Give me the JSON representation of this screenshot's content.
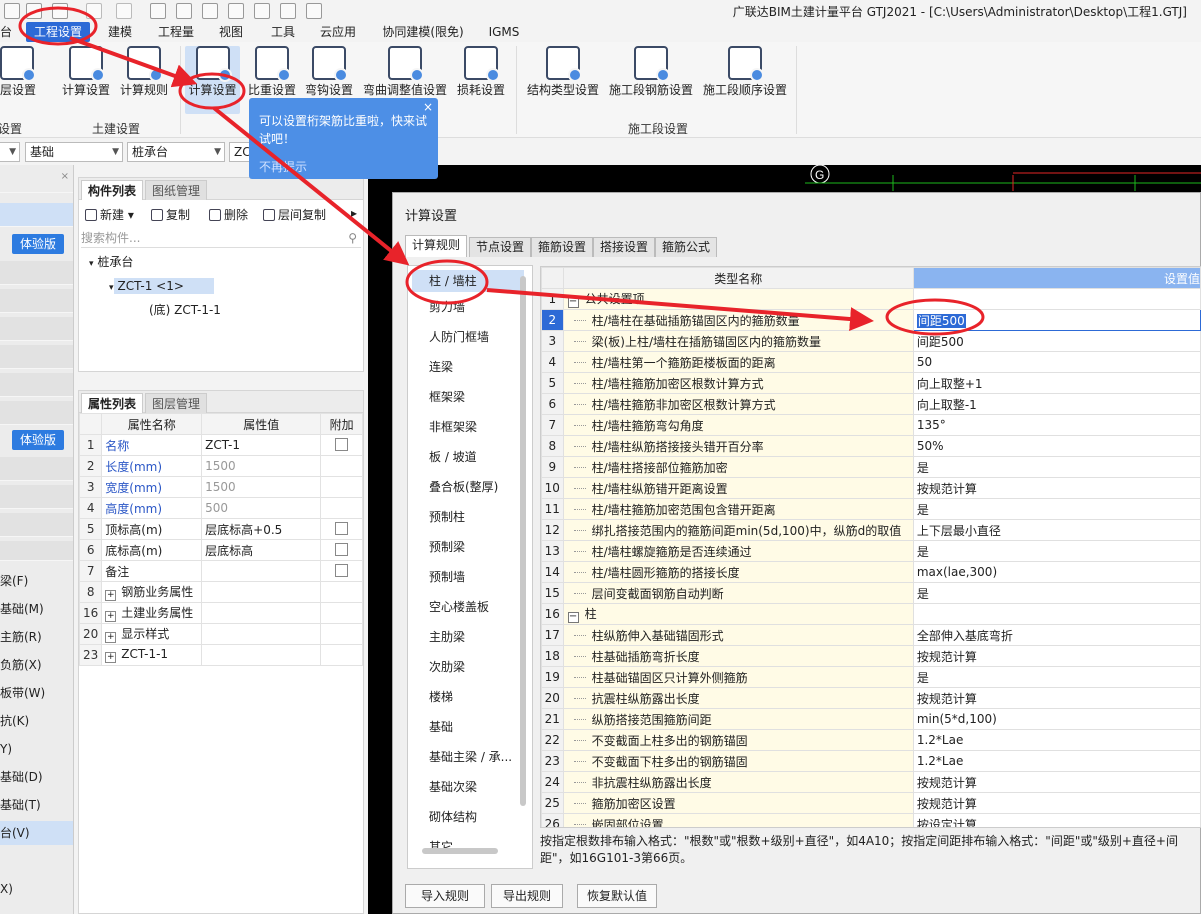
{
  "app": {
    "title": "广联达BIM土建计量平台 GTJ2021 - [C:\\Users\\Administrator\\Desktop\\工程1.GTJ]"
  },
  "menu": {
    "items": [
      "台",
      "工程设置",
      "建模",
      "工程量",
      "视图",
      "工具",
      "云应用",
      "协同建模(限免)",
      "IGMS"
    ],
    "active_index": 1
  },
  "ribbon": {
    "buttons": [
      "楼层设置",
      "计算设置",
      "计算规则",
      "计算设置",
      "比重设置",
      "弯钩设置",
      "弯曲调整值设置",
      "损耗设置",
      "结构类型设置",
      "施工段钢筋设置",
      "施工段顺序设置"
    ],
    "groups": [
      "设置",
      "土建设置",
      "施工段设置"
    ]
  },
  "tooltip": {
    "text": "可以设置桁架筋比重啦，快来试试吧！",
    "dismiss": "不再提示",
    "close": "×"
  },
  "dropdowns": [
    "基础",
    "桩承台",
    "ZC"
  ],
  "leftstrip": {
    "trial_label": "体验版",
    "items": [
      "梁(F)",
      "基础(M)",
      "主筋(R)",
      "负筋(X)",
      "板带(W)",
      "抗(K)",
      "Y)",
      "基础(D)",
      "基础(T)",
      "台(V)",
      "X)"
    ],
    "selected_index": 9
  },
  "component_list": {
    "tabs": [
      "构件列表",
      "图纸管理"
    ],
    "toolbar": [
      "新建",
      "复制",
      "删除",
      "层间复制"
    ],
    "more": "▸",
    "search_placeholder": "搜索构件...",
    "tree": {
      "root": "桩承台",
      "child": "ZCT-1 <1>",
      "leaf": "(底) ZCT-1-1"
    }
  },
  "property_list": {
    "tabs": [
      "属性列表",
      "图层管理"
    ],
    "headers": [
      "属性名称",
      "属性值",
      "附加"
    ],
    "rows": [
      {
        "no": "1",
        "name": "名称",
        "value": "ZCT-1",
        "check": false,
        "blue": true,
        "gray": false,
        "plus": false
      },
      {
        "no": "2",
        "name": "长度(mm)",
        "value": "1500",
        "check": null,
        "blue": true,
        "gray": true,
        "plus": false
      },
      {
        "no": "3",
        "name": "宽度(mm)",
        "value": "1500",
        "check": null,
        "blue": true,
        "gray": true,
        "plus": false
      },
      {
        "no": "4",
        "name": "高度(mm)",
        "value": "500",
        "check": null,
        "blue": true,
        "gray": true,
        "plus": false
      },
      {
        "no": "5",
        "name": "顶标高(m)",
        "value": "层底标高+0.5",
        "check": false,
        "blue": false,
        "gray": false,
        "plus": false
      },
      {
        "no": "6",
        "name": "底标高(m)",
        "value": "层底标高",
        "check": false,
        "blue": false,
        "gray": false,
        "plus": false
      },
      {
        "no": "7",
        "name": "备注",
        "value": "",
        "check": false,
        "blue": false,
        "gray": false,
        "plus": false
      },
      {
        "no": "8",
        "name": "钢筋业务属性",
        "value": "",
        "check": null,
        "blue": false,
        "gray": false,
        "plus": true
      },
      {
        "no": "16",
        "name": "土建业务属性",
        "value": "",
        "check": null,
        "blue": false,
        "gray": false,
        "plus": true
      },
      {
        "no": "20",
        "name": "显示样式",
        "value": "",
        "check": null,
        "blue": false,
        "gray": false,
        "plus": true
      },
      {
        "no": "23",
        "name": "ZCT-1-1",
        "value": "",
        "check": null,
        "blue": false,
        "gray": false,
        "plus": true
      }
    ]
  },
  "canvas": {
    "axis_label": "G"
  },
  "dialog": {
    "title": "计算设置",
    "tabs": [
      "计算规则",
      "节点设置",
      "箍筋设置",
      "搭接设置",
      "箍筋公式"
    ],
    "categories": [
      "柱 / 墙柱",
      "剪力墙",
      "人防门框墙",
      "连梁",
      "框架梁",
      "非框架梁",
      "板 / 坡道",
      "叠合板(整厚)",
      "预制柱",
      "预制梁",
      "预制墙",
      "空心楼盖板",
      "主肋梁",
      "次肋梁",
      "楼梯",
      "基础",
      "基础主梁 / 承...",
      "基础次梁",
      "砌体结构",
      "其它"
    ],
    "selected_category": 0,
    "col_name": "类型名称",
    "col_value": "设置值",
    "rows": [
      {
        "no": "1",
        "name": "公共设置项",
        "value": "",
        "group": true
      },
      {
        "no": "2",
        "name": "柱/墙柱在基础插筋锚固区内的箍筋数量",
        "value": "间距500",
        "group": false,
        "selected": true
      },
      {
        "no": "3",
        "name": "梁(板)上柱/墙柱在插筋锚固区内的箍筋数量",
        "value": "间距500",
        "group": false
      },
      {
        "no": "4",
        "name": "柱/墙柱第一个箍筋距楼板面的距离",
        "value": "50",
        "group": false
      },
      {
        "no": "5",
        "name": "柱/墙柱箍筋加密区根数计算方式",
        "value": "向上取整+1",
        "group": false
      },
      {
        "no": "6",
        "name": "柱/墙柱箍筋非加密区根数计算方式",
        "value": "向上取整-1",
        "group": false
      },
      {
        "no": "7",
        "name": "柱/墙柱箍筋弯勾角度",
        "value": "135°",
        "group": false
      },
      {
        "no": "8",
        "name": "柱/墙柱纵筋搭接接头错开百分率",
        "value": "50%",
        "group": false
      },
      {
        "no": "9",
        "name": "柱/墙柱搭接部位箍筋加密",
        "value": "是",
        "group": false
      },
      {
        "no": "10",
        "name": "柱/墙柱纵筋错开距离设置",
        "value": "按规范计算",
        "group": false
      },
      {
        "no": "11",
        "name": "柱/墙柱箍筋加密范围包含错开距离",
        "value": "是",
        "group": false
      },
      {
        "no": "12",
        "name": "绑扎搭接范围内的箍筋间距min(5d,100)中，纵筋d的取值",
        "value": "上下层最小直径",
        "group": false
      },
      {
        "no": "13",
        "name": "柱/墙柱螺旋箍筋是否连续通过",
        "value": "是",
        "group": false
      },
      {
        "no": "14",
        "name": "柱/墙柱圆形箍筋的搭接长度",
        "value": "max(lae,300)",
        "group": false
      },
      {
        "no": "15",
        "name": "层间变截面钢筋自动判断",
        "value": "是",
        "group": false
      },
      {
        "no": "16",
        "name": "柱",
        "value": "",
        "group": true
      },
      {
        "no": "17",
        "name": "柱纵筋伸入基础锚固形式",
        "value": "全部伸入基底弯折",
        "group": false
      },
      {
        "no": "18",
        "name": "柱基础插筋弯折长度",
        "value": "按规范计算",
        "group": false
      },
      {
        "no": "19",
        "name": "柱基础锚固区只计算外侧箍筋",
        "value": "是",
        "group": false
      },
      {
        "no": "20",
        "name": "抗震柱纵筋露出长度",
        "value": "按规范计算",
        "group": false
      },
      {
        "no": "21",
        "name": "纵筋搭接范围箍筋间距",
        "value": "min(5*d,100)",
        "group": false
      },
      {
        "no": "22",
        "name": "不变截面上柱多出的钢筋锚固",
        "value": "1.2*Lae",
        "group": false
      },
      {
        "no": "23",
        "name": "不变截面下柱多出的钢筋锚固",
        "value": "1.2*Lae",
        "group": false
      },
      {
        "no": "24",
        "name": "非抗震柱纵筋露出长度",
        "value": "按规范计算",
        "group": false
      },
      {
        "no": "25",
        "name": "箍筋加密区设置",
        "value": "按规范计算",
        "group": false
      },
      {
        "no": "26",
        "name": "嵌固部位设置",
        "value": "按设定计算",
        "group": false
      }
    ],
    "hint": "按指定根数排布输入格式：\"根数\"或\"根数+级别+直径\"，如4A10；按指定间距排布输入格式：\"间距\"或\"级别+直径+间距\"，如16G101-3第66页。",
    "buttons": [
      "导入规则",
      "导出规则",
      "恢复默认值"
    ]
  },
  "colors": {
    "accent": "#2d6ad6",
    "tooltip": "#4d8fe6",
    "annotation": "#e8232a",
    "canvas": "#000000"
  }
}
